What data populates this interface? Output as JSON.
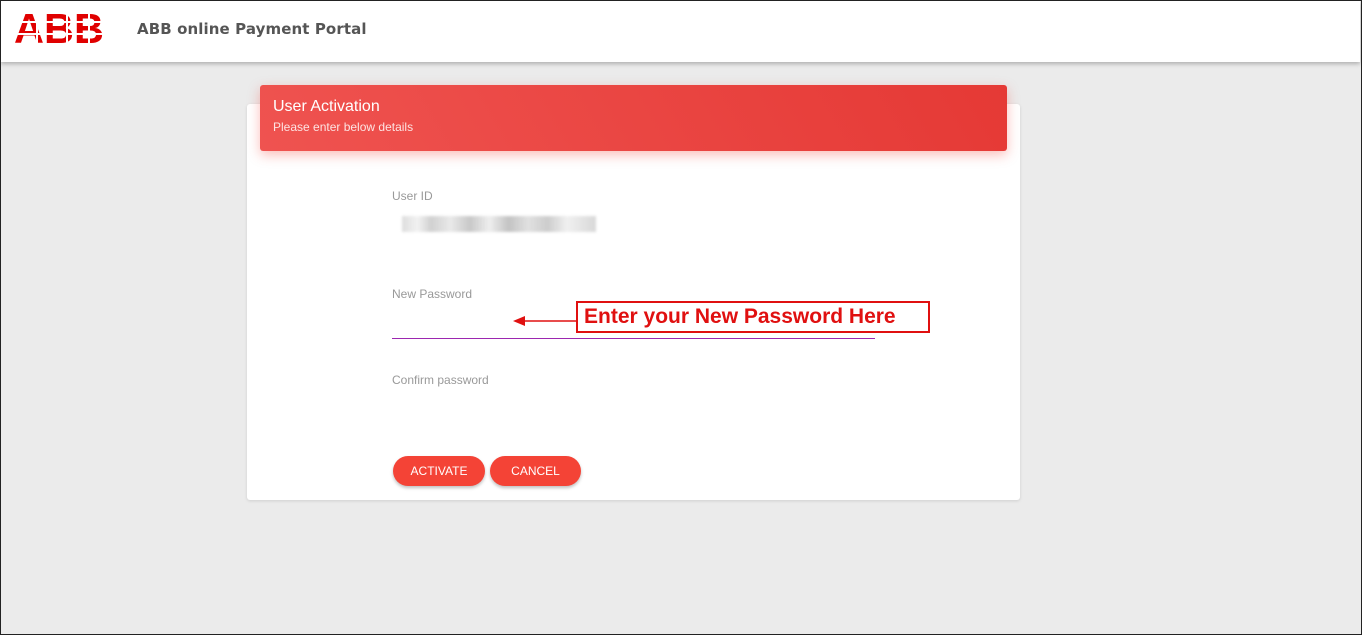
{
  "header": {
    "logo_text": "ABB",
    "portal_title": "ABB online Payment Portal"
  },
  "card": {
    "title": "User Activation",
    "subtitle": "Please enter below details"
  },
  "form": {
    "user_id_label": "User ID",
    "user_id_value": "",
    "new_password_label": "New Password",
    "confirm_password_label": "Confirm password"
  },
  "buttons": {
    "activate": "ACTIVATE",
    "cancel": "CANCEL"
  },
  "annotation": {
    "text": "Enter your New Password Here"
  },
  "colors": {
    "brand_red": "#e00000",
    "header_gradient_start": "#ef5350",
    "header_gradient_end": "#e53935",
    "button_red": "#f44336",
    "input_underline": "#9c27b0",
    "annotation_red": "#e01010"
  }
}
